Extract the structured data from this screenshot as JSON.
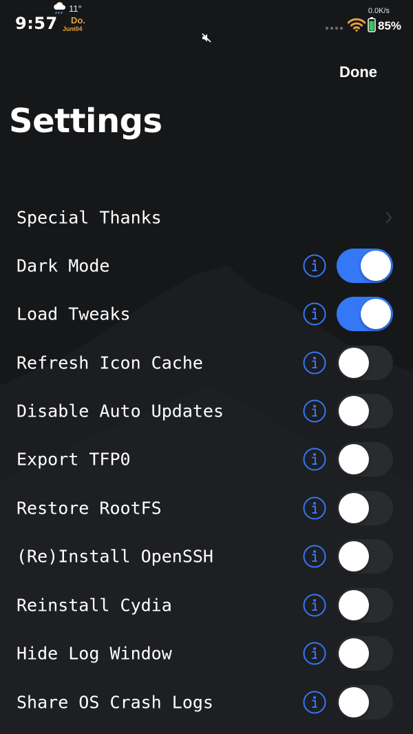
{
  "status_bar": {
    "time": "9:57",
    "temperature": "11°",
    "day": "Do.",
    "month": "Juni04",
    "net_speed": "0.0K/s",
    "battery": "85%",
    "weather_icon": "rain-cloud-icon",
    "mute_icon": "muted-speaker-icon"
  },
  "header": {
    "done_label": "Done",
    "title": "Settings"
  },
  "colors": {
    "background": "#161719",
    "toggle_on": "#3478f6",
    "toggle_off": "#2a2b2e",
    "info_accent": "#3478f6",
    "status_accent": "#e5a23c"
  },
  "settings": [
    {
      "label": "Special Thanks",
      "type": "link"
    },
    {
      "label": "Dark Mode",
      "type": "toggle",
      "on": true
    },
    {
      "label": "Load Tweaks",
      "type": "toggle",
      "on": true
    },
    {
      "label": "Refresh Icon Cache",
      "type": "toggle",
      "on": false
    },
    {
      "label": "Disable Auto Updates",
      "type": "toggle",
      "on": false
    },
    {
      "label": "Export TFP0",
      "type": "toggle",
      "on": false
    },
    {
      "label": "Restore RootFS",
      "type": "toggle",
      "on": false
    },
    {
      "label": "(Re)Install OpenSSH",
      "type": "toggle",
      "on": false
    },
    {
      "label": "Reinstall Cydia",
      "type": "toggle",
      "on": false
    },
    {
      "label": "Hide Log Window",
      "type": "toggle",
      "on": false
    },
    {
      "label": "Share OS Crash Logs",
      "type": "toggle",
      "on": false
    }
  ]
}
